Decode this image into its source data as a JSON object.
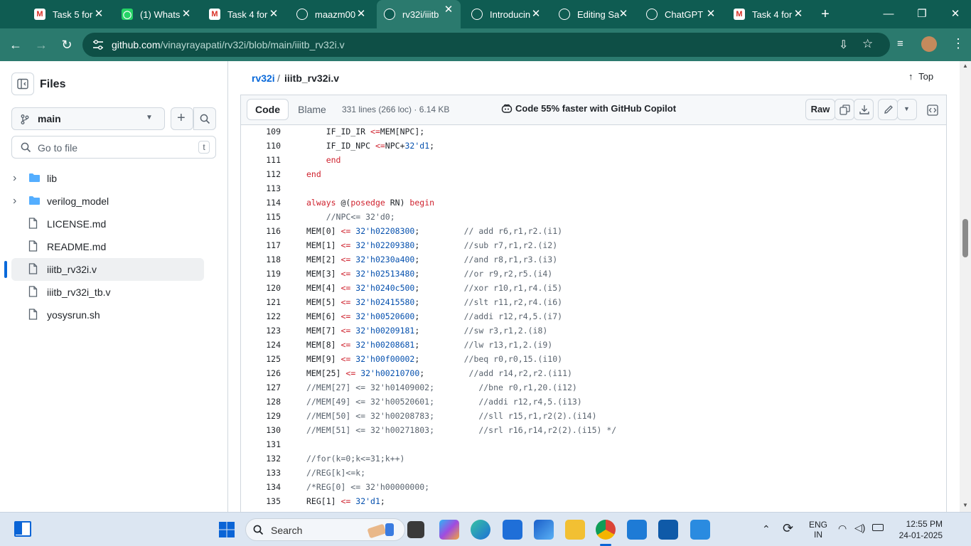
{
  "browser": {
    "tabs": [
      {
        "title": "Task 5 for",
        "icon": "gmail-icon",
        "active": false
      },
      {
        "title": "(1) Whats",
        "icon": "whatsapp-icon",
        "active": false
      },
      {
        "title": "Task 4 for",
        "icon": "gmail-icon",
        "active": false
      },
      {
        "title": "maazm00",
        "icon": "github-icon",
        "active": false
      },
      {
        "title": "rv32i/iiitb",
        "icon": "github-icon",
        "active": true
      },
      {
        "title": "Introducin",
        "icon": "openai-icon",
        "active": false
      },
      {
        "title": "Editing Sa",
        "icon": "github-icon",
        "active": false
      },
      {
        "title": "ChatGPT",
        "icon": "openai-icon",
        "active": false
      },
      {
        "title": "Task 4 for",
        "icon": "gmail-icon",
        "active": false
      }
    ],
    "new_tab": "+",
    "url_host": "github.com",
    "url_path": "/vinayrayapati/rv32i/blob/main/iiitb_rv32i.v"
  },
  "sidebar": {
    "title": "Files",
    "branch": "main",
    "goto_placeholder": "Go to file",
    "goto_shortcut": "t",
    "items": [
      {
        "name": "lib",
        "type": "folder"
      },
      {
        "name": "verilog_model",
        "type": "folder"
      },
      {
        "name": "LICENSE.md",
        "type": "file"
      },
      {
        "name": "README.md",
        "type": "file"
      },
      {
        "name": "iiitb_rv32i.v",
        "type": "file",
        "selected": true
      },
      {
        "name": "iiitb_rv32i_tb.v",
        "type": "file"
      },
      {
        "name": "yosysrun.sh",
        "type": "file"
      }
    ]
  },
  "main": {
    "breadcrumb_repo": "rv32i",
    "breadcrumb_sep": "/",
    "breadcrumb_file": "iiitb_rv32i.v",
    "top_label": "Top",
    "tab_code": "Code",
    "tab_blame": "Blame",
    "file_info": "331 lines (266 loc) · 6.14 KB",
    "copilot": "Code 55% faster with GitHub Copilot",
    "raw_label": "Raw"
  },
  "code_lines": [
    {
      "n": "109",
      "t": "    IF_ID_IR <=MEM[NPC];"
    },
    {
      "n": "110",
      "t": "    IF_ID_NPC <=NPC+32'd1;"
    },
    {
      "n": "111",
      "t": "    end"
    },
    {
      "n": "112",
      "t": "end"
    },
    {
      "n": "113",
      "t": ""
    },
    {
      "n": "114",
      "t": "always @(posedge RN) begin"
    },
    {
      "n": "115",
      "t": "    //NPC<= 32'd0;"
    },
    {
      "n": "116",
      "t": "MEM[0] <= 32'h02208300;         // add r6,r1,r2.(i1)"
    },
    {
      "n": "117",
      "t": "MEM[1] <= 32'h02209380;         //sub r7,r1,r2.(i2)"
    },
    {
      "n": "118",
      "t": "MEM[2] <= 32'h0230a400;         //and r8,r1,r3.(i3)"
    },
    {
      "n": "119",
      "t": "MEM[3] <= 32'h02513480;         //or r9,r2,r5.(i4)"
    },
    {
      "n": "120",
      "t": "MEM[4] <= 32'h0240c500;         //xor r10,r1,r4.(i5)"
    },
    {
      "n": "121",
      "t": "MEM[5] <= 32'h02415580;         //slt r11,r2,r4.(i6)"
    },
    {
      "n": "122",
      "t": "MEM[6] <= 32'h00520600;         //addi r12,r4,5.(i7)"
    },
    {
      "n": "123",
      "t": "MEM[7] <= 32'h00209181;         //sw r3,r1,2.(i8)"
    },
    {
      "n": "124",
      "t": "MEM[8] <= 32'h00208681;         //lw r13,r1,2.(i9)"
    },
    {
      "n": "125",
      "t": "MEM[9] <= 32'h00f00002;         //beq r0,r0,15.(i10)"
    },
    {
      "n": "126",
      "t": "MEM[25] <= 32'h00210700;         //add r14,r2,r2.(i11)"
    },
    {
      "n": "127",
      "t": "//MEM[27] <= 32'h01409002;         //bne r0,r1,20.(i12)"
    },
    {
      "n": "128",
      "t": "//MEM[49] <= 32'h00520601;         //addi r12,r4,5.(i13)"
    },
    {
      "n": "129",
      "t": "//MEM[50] <= 32'h00208783;         //sll r15,r1,r2(2).(i14)"
    },
    {
      "n": "130",
      "t": "//MEM[51] <= 32'h00271803;         //srl r16,r14,r2(2).(i15) */"
    },
    {
      "n": "131",
      "t": ""
    },
    {
      "n": "132",
      "t": "//for(k=0;k<=31;k++)"
    },
    {
      "n": "133",
      "t": "//REG[k]<=k;"
    },
    {
      "n": "134",
      "t": "/*REG[0] <= 32'h00000000;"
    },
    {
      "n": "135",
      "t": "REG[1] <= 32'd1;"
    }
  ],
  "taskbar": {
    "search_label": "Search",
    "lang_top": "ENG",
    "lang_bottom": "IN",
    "time": "12:55 PM",
    "date": "24-01-2025"
  },
  "colors": {
    "chrome_dark": "#0f5c52",
    "chrome_light": "#2b7a6e",
    "link": "#0969da",
    "keyword": "#cf222e",
    "number": "#0550ae"
  }
}
